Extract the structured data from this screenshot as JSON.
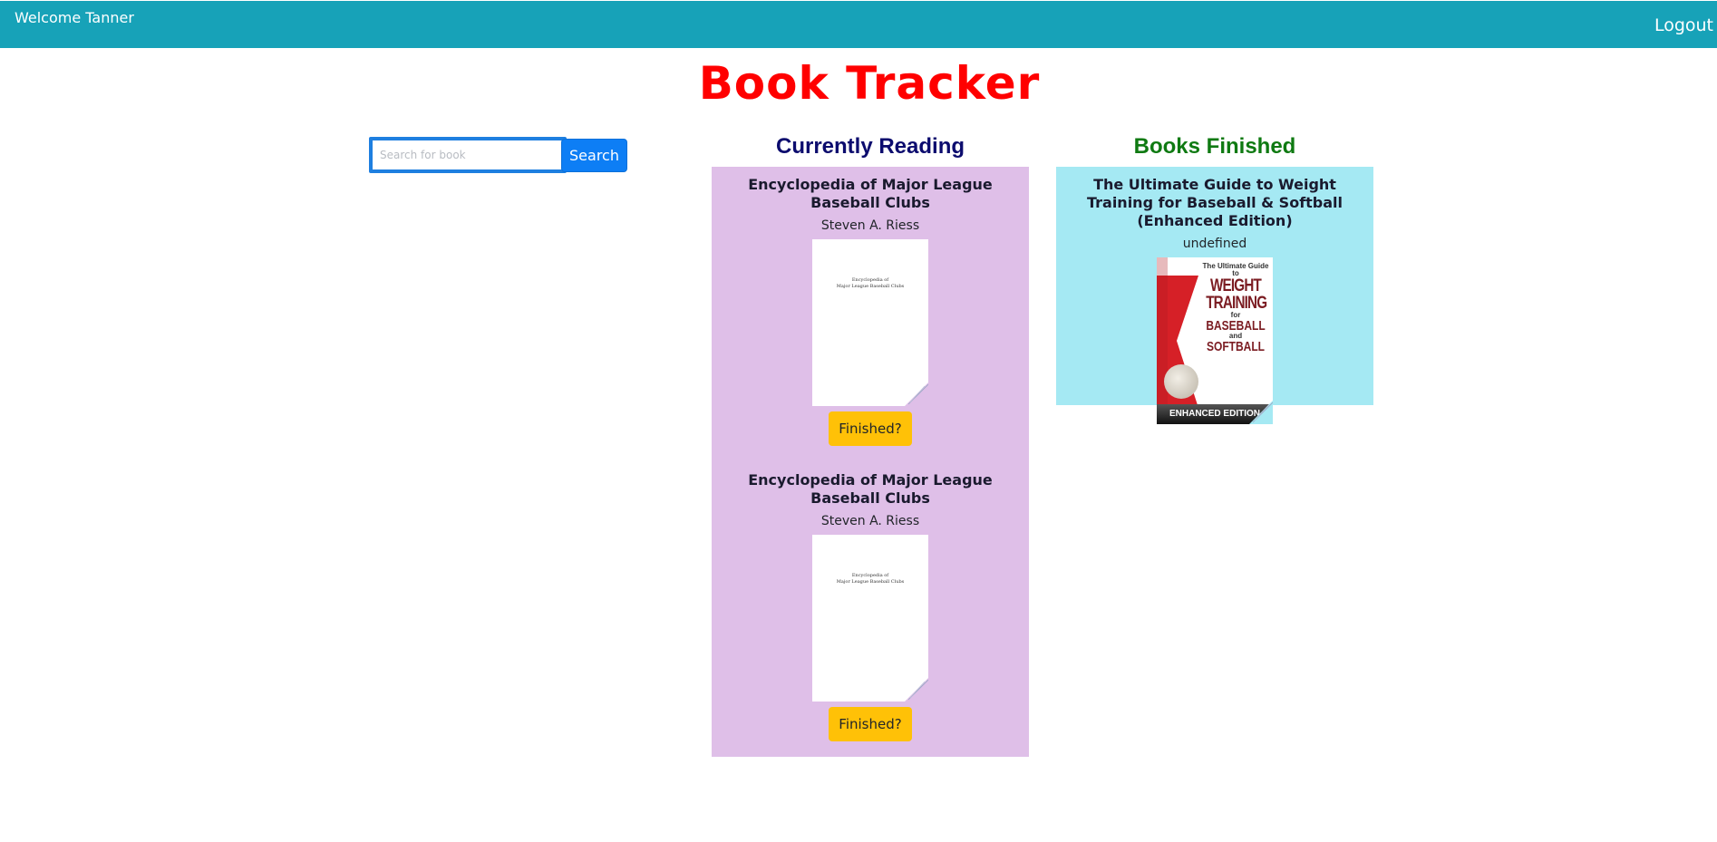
{
  "navbar": {
    "welcome_text": "Welcome Tanner",
    "logout_label": "Logout",
    "background_color": "#17a2b8"
  },
  "app_title": "Book Tracker",
  "search": {
    "placeholder": "Search for book",
    "value": "",
    "button_label": "Search"
  },
  "currently_reading": {
    "heading": "Currently Reading",
    "panel_color": "#dfbfe8",
    "books": [
      {
        "title": "Encyclopedia of Major League Baseball Clubs",
        "author": "Steven A. Riess",
        "cover_text_line1": "Encyclopedia of",
        "cover_text_line2": "Major League Baseball Clubs",
        "button_label": "Finished?"
      },
      {
        "title": "Encyclopedia of Major League Baseball Clubs",
        "author": "Steven A. Riess",
        "cover_text_line1": "Encyclopedia of",
        "cover_text_line2": "Major League Baseball Clubs",
        "button_label": "Finished?"
      }
    ]
  },
  "books_finished": {
    "heading": "Books Finished",
    "panel_color": "#a5e9f3",
    "books": [
      {
        "title": "The Ultimate Guide to Weight Training for Baseball & Softball (Enhanced Edition)",
        "author": "undefined",
        "cover_text": {
          "line1": "The Ultimate Guide to",
          "line2": "WEIGHT",
          "line3": "TRAINING",
          "line4": "for",
          "line5": "BASEBALL",
          "line6": "and",
          "line7": "SOFTBALL",
          "banner": "ENHANCED EDITION"
        }
      }
    ]
  },
  "colors": {
    "title_red": "#ff0000",
    "search_blue": "#0d7ef5",
    "finished_button_yellow": "#ffc107",
    "reading_heading_navy": "#0c0c6e",
    "finished_heading_green": "#0f7a12"
  }
}
